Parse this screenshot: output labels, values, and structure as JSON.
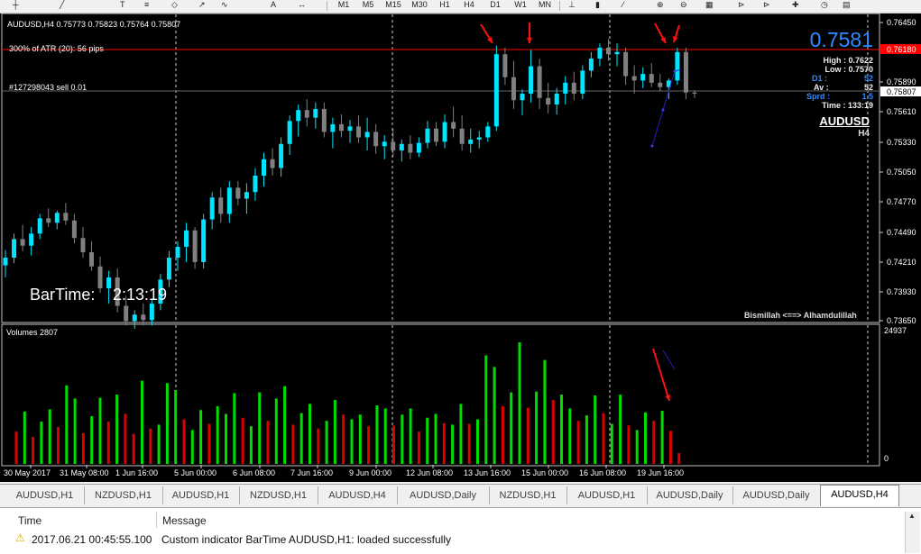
{
  "toolbar": {
    "timeframes": [
      "M1",
      "M5",
      "M15",
      "M30",
      "H1",
      "H4",
      "D1",
      "W1",
      "MN"
    ]
  },
  "chart": {
    "header": "AUDUSD,H4  0.75773 0.75823 0.75764 0.75807",
    "atr_label": "300% of ATR (20):   56 pips",
    "order_label": "#127298043 sell 0.01",
    "bar_time_label": "BarTime:",
    "bar_time_value": "2:13:19",
    "bismillah": "Bismillah <==> Alhamdulillah",
    "big_price": "0.7581",
    "info": {
      "high": "High : 0.7622",
      "low": "Low : 0.7570",
      "d1": "D1 :",
      "d1_val": "52",
      "av": "Av :",
      "av_val": "52",
      "sprd": "Sprd :",
      "sprd_val": "1.5",
      "time": "Time : 133:19"
    },
    "symbol": "AUDUSD",
    "period": "H4",
    "price_axis": [
      "0.76450",
      "0.75890",
      "0.75610",
      "0.75330",
      "0.75050",
      "0.74770",
      "0.74490",
      "0.74210",
      "0.73930",
      "0.73650"
    ],
    "red_line_label": "0.76180",
    "current_price_label": "0.75807",
    "volume_label": "Volumes 2807",
    "volume_max_label": "24937",
    "volume_zero_label": "0",
    "time_axis": [
      "30 May 2017",
      "31 May 08:00",
      "1 Jun 16:00",
      "5 Jun 00:00",
      "6 Jun 08:00",
      "7 Jun 16:00",
      "9 Jun 00:00",
      "12 Jun 08:00",
      "13 Jun 16:00",
      "15 Jun 00:00",
      "16 Jun 08:00",
      "19 Jun 16:00"
    ],
    "colors": {
      "up": "#00e5ff",
      "down": "#808080",
      "vol_up": "#00dd00",
      "vol_down": "#dd0000",
      "red_line": "#ff0000"
    }
  },
  "chart_data": {
    "type": "candlestick",
    "symbol": "AUDUSD",
    "timeframe": "H4",
    "ylim": [
      0.7365,
      0.7645
    ],
    "candles": [
      [
        0.7423,
        0.7437,
        0.7412,
        0.743
      ],
      [
        0.743,
        0.7452,
        0.7425,
        0.7447
      ],
      [
        0.7447,
        0.746,
        0.7436,
        0.7441
      ],
      [
        0.7441,
        0.7458,
        0.7432,
        0.7452
      ],
      [
        0.7452,
        0.747,
        0.7447,
        0.7466
      ],
      [
        0.7466,
        0.7475,
        0.7458,
        0.7462
      ],
      [
        0.7462,
        0.7473,
        0.7456,
        0.7471
      ],
      [
        0.7471,
        0.748,
        0.746,
        0.7464
      ],
      [
        0.7464,
        0.747,
        0.7443,
        0.7448
      ],
      [
        0.7448,
        0.7458,
        0.743,
        0.7435
      ],
      [
        0.7435,
        0.7445,
        0.7418,
        0.7422
      ],
      [
        0.7422,
        0.7431,
        0.7398,
        0.7402
      ],
      [
        0.7402,
        0.7418,
        0.7388,
        0.7412
      ],
      [
        0.7412,
        0.742,
        0.738,
        0.7386
      ],
      [
        0.7386,
        0.7395,
        0.7368,
        0.7372
      ],
      [
        0.7372,
        0.7382,
        0.7365,
        0.7378
      ],
      [
        0.7378,
        0.7388,
        0.7368,
        0.7373
      ],
      [
        0.7373,
        0.7392,
        0.7368,
        0.7388
      ],
      [
        0.7388,
        0.7415,
        0.7382,
        0.741
      ],
      [
        0.741,
        0.7436,
        0.7403,
        0.743
      ],
      [
        0.743,
        0.7445,
        0.7418,
        0.744
      ],
      [
        0.744,
        0.7462,
        0.7426,
        0.7455
      ],
      [
        0.7455,
        0.7458,
        0.742,
        0.7426
      ],
      [
        0.7426,
        0.747,
        0.742,
        0.7465
      ],
      [
        0.7465,
        0.749,
        0.7456,
        0.7485
      ],
      [
        0.7485,
        0.7494,
        0.7462,
        0.747
      ],
      [
        0.747,
        0.75,
        0.7462,
        0.7494
      ],
      [
        0.7494,
        0.75,
        0.7478,
        0.7484
      ],
      [
        0.7484,
        0.7498,
        0.747,
        0.749
      ],
      [
        0.749,
        0.7512,
        0.7482,
        0.7505
      ],
      [
        0.7505,
        0.7526,
        0.7495,
        0.752
      ],
      [
        0.752,
        0.753,
        0.7505,
        0.7512
      ],
      [
        0.7512,
        0.754,
        0.7504,
        0.7534
      ],
      [
        0.7534,
        0.756,
        0.7524,
        0.7555
      ],
      [
        0.7555,
        0.757,
        0.7541,
        0.7565
      ],
      [
        0.7565,
        0.7575,
        0.755,
        0.7558
      ],
      [
        0.7558,
        0.7572,
        0.7548,
        0.7566
      ],
      [
        0.7566,
        0.7572,
        0.754,
        0.7545
      ],
      [
        0.7545,
        0.7558,
        0.753,
        0.7552
      ],
      [
        0.7552,
        0.7561,
        0.754,
        0.7546
      ],
      [
        0.7546,
        0.7556,
        0.7535,
        0.755
      ],
      [
        0.755,
        0.756,
        0.7535,
        0.754
      ],
      [
        0.754,
        0.7558,
        0.7528,
        0.7545
      ],
      [
        0.7545,
        0.7552,
        0.7525,
        0.7532
      ],
      [
        0.7532,
        0.7542,
        0.752,
        0.7536
      ],
      [
        0.7536,
        0.7548,
        0.7522,
        0.7528
      ],
      [
        0.7528,
        0.7538,
        0.7518,
        0.7534
      ],
      [
        0.7534,
        0.7542,
        0.752,
        0.7526
      ],
      [
        0.7526,
        0.754,
        0.7522,
        0.7535
      ],
      [
        0.7535,
        0.7555,
        0.753,
        0.7548
      ],
      [
        0.7548,
        0.7554,
        0.7532,
        0.7536
      ],
      [
        0.7536,
        0.7561,
        0.753,
        0.7554
      ],
      [
        0.7554,
        0.7568,
        0.754,
        0.7548
      ],
      [
        0.7548,
        0.756,
        0.7528,
        0.7534
      ],
      [
        0.7534,
        0.7548,
        0.7526,
        0.7538
      ],
      [
        0.7538,
        0.7546,
        0.753,
        0.754
      ],
      [
        0.754,
        0.7554,
        0.7536,
        0.755
      ],
      [
        0.755,
        0.7624,
        0.7546,
        0.7616
      ],
      [
        0.7616,
        0.7622,
        0.7588,
        0.7595
      ],
      [
        0.7595,
        0.761,
        0.7566,
        0.7574
      ],
      [
        0.7574,
        0.7584,
        0.756,
        0.758
      ],
      [
        0.758,
        0.762,
        0.7572,
        0.7605
      ],
      [
        0.7605,
        0.7612,
        0.7566,
        0.7576
      ],
      [
        0.7576,
        0.759,
        0.7562,
        0.757
      ],
      [
        0.757,
        0.7585,
        0.7561,
        0.758
      ],
      [
        0.758,
        0.7596,
        0.757,
        0.759
      ],
      [
        0.759,
        0.76,
        0.7574,
        0.758
      ],
      [
        0.758,
        0.7606,
        0.7575,
        0.7601
      ],
      [
        0.7601,
        0.7618,
        0.7595,
        0.7612
      ],
      [
        0.7612,
        0.7626,
        0.7605,
        0.7622
      ],
      [
        0.7622,
        0.763,
        0.761,
        0.7616
      ],
      [
        0.7616,
        0.7626,
        0.7605,
        0.7618
      ],
      [
        0.7618,
        0.7622,
        0.7588,
        0.7596
      ],
      [
        0.7596,
        0.7606,
        0.758,
        0.7592
      ],
      [
        0.7592,
        0.7604,
        0.7585,
        0.7598
      ],
      [
        0.7598,
        0.7608,
        0.7586,
        0.759
      ],
      [
        0.759,
        0.7598,
        0.7582,
        0.7586
      ],
      [
        0.7586,
        0.7594,
        0.7575,
        0.7592
      ],
      [
        0.7592,
        0.7622,
        0.7588,
        0.7618
      ],
      [
        0.7618,
        0.7622,
        0.7575,
        0.7581
      ],
      [
        0.7581,
        0.7583,
        0.7576,
        0.758
      ]
    ],
    "volumes": [
      [
        4.2,
        false
      ],
      [
        6.8,
        true
      ],
      [
        3.5,
        false
      ],
      [
        5.5,
        true
      ],
      [
        7.1,
        true
      ],
      [
        4.8,
        false
      ],
      [
        10.2,
        true
      ],
      [
        8.5,
        true
      ],
      [
        4.0,
        false
      ],
      [
        6.2,
        true
      ],
      [
        8.6,
        true
      ],
      [
        5.5,
        false
      ],
      [
        9.0,
        true
      ],
      [
        6.5,
        false
      ],
      [
        3.9,
        false
      ],
      [
        10.8,
        true
      ],
      [
        4.6,
        false
      ],
      [
        5.1,
        true
      ],
      [
        10.5,
        true
      ],
      [
        9.6,
        true
      ],
      [
        5.8,
        false
      ],
      [
        4.4,
        true
      ],
      [
        7.0,
        true
      ],
      [
        5.2,
        false
      ],
      [
        7.5,
        true
      ],
      [
        6.5,
        true
      ],
      [
        9.2,
        true
      ],
      [
        6.0,
        false
      ],
      [
        4.9,
        true
      ],
      [
        9.3,
        true
      ],
      [
        5.6,
        false
      ],
      [
        8.5,
        true
      ],
      [
        10.1,
        true
      ],
      [
        5.1,
        false
      ],
      [
        6.6,
        true
      ],
      [
        7.8,
        true
      ],
      [
        4.6,
        false
      ],
      [
        5.6,
        true
      ],
      [
        8.3,
        true
      ],
      [
        6.4,
        false
      ],
      [
        5.8,
        true
      ],
      [
        6.4,
        true
      ],
      [
        4.9,
        false
      ],
      [
        7.6,
        true
      ],
      [
        7.2,
        true
      ],
      [
        5.0,
        false
      ],
      [
        6.4,
        true
      ],
      [
        7.2,
        true
      ],
      [
        4.2,
        false
      ],
      [
        6.0,
        true
      ],
      [
        6.5,
        true
      ],
      [
        5.3,
        false
      ],
      [
        5.1,
        true
      ],
      [
        7.8,
        true
      ],
      [
        5.2,
        false
      ],
      [
        5.8,
        true
      ],
      [
        14.1,
        true
      ],
      [
        12.6,
        true
      ],
      [
        7.5,
        false
      ],
      [
        9.3,
        true
      ],
      [
        15.8,
        true
      ],
      [
        7.3,
        false
      ],
      [
        9.4,
        true
      ],
      [
        13.5,
        true
      ],
      [
        8.3,
        false
      ],
      [
        9.0,
        true
      ],
      [
        7.2,
        true
      ],
      [
        5.6,
        false
      ],
      [
        6.3,
        true
      ],
      [
        8.9,
        true
      ],
      [
        6.6,
        false
      ],
      [
        5.2,
        true
      ],
      [
        9.0,
        true
      ],
      [
        5.0,
        false
      ],
      [
        4.4,
        true
      ],
      [
        6.7,
        true
      ],
      [
        5.6,
        false
      ],
      [
        6.9,
        true
      ],
      [
        4.3,
        false
      ],
      [
        1.4,
        false
      ]
    ],
    "xlabel": "",
    "ylabel": ""
  },
  "tabs": [
    "AUDUSD,H1",
    "NZDUSD,H1",
    "AUDUSD,H1",
    "NZDUSD,H1",
    "AUDUSD,H4",
    "AUDUSD,Daily",
    "NZDUSD,H1",
    "AUDUSD,H1",
    "AUDUSD,Daily",
    "AUDUSD,Daily",
    "AUDUSD,H4"
  ],
  "log": {
    "col_time": "Time",
    "col_message": "Message",
    "row1_time": "2017.06.21 00:45:55.100",
    "row1_message": "Custom indicator BarTime AUDUSD,H1: loaded successfully"
  }
}
